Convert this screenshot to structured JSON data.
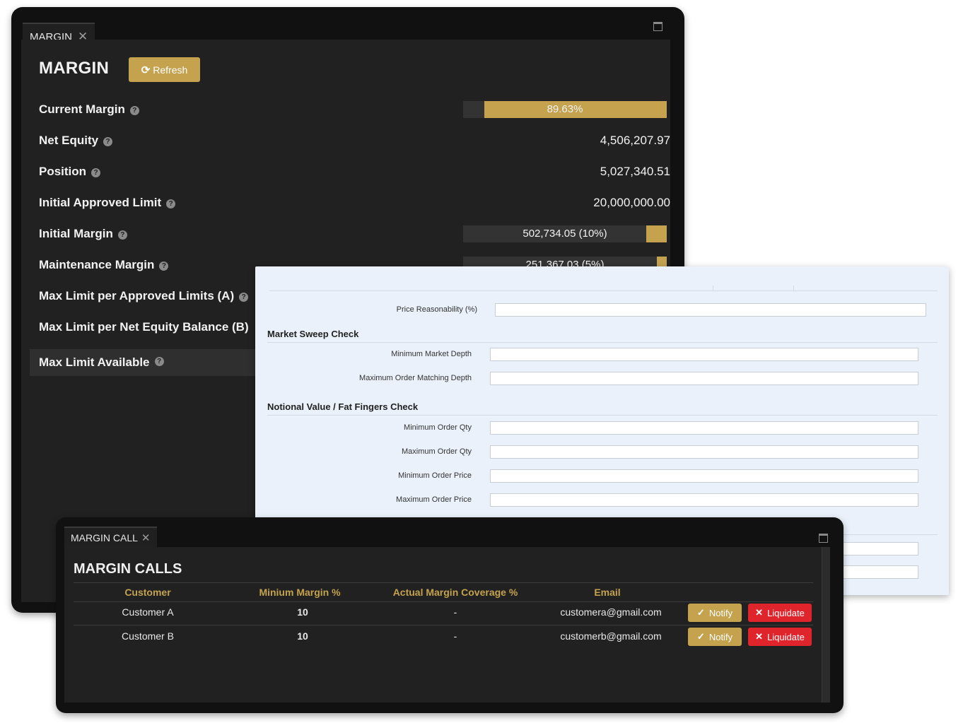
{
  "margin_window": {
    "tab_label": "MARGIN",
    "tab_close": "✕",
    "title": "MARGIN",
    "refresh_label": "Refresh",
    "rows": [
      {
        "label": "Current Margin",
        "bar_text": "89.63%",
        "bar_fill_percent": 89.63
      },
      {
        "label": "Net Equity",
        "value": "4,506,207.97"
      },
      {
        "label": "Position",
        "value": "5,027,340.51"
      },
      {
        "label": "Initial Approved Limit",
        "value": "20,000,000.00"
      },
      {
        "label": "Initial Margin",
        "bar_text": "502,734.05 (10%)",
        "bar_fill_percent": 10
      },
      {
        "label": "Maintenance Margin",
        "bar_text": "251,367.03 (5%)",
        "bar_fill_percent": 5
      },
      {
        "label": "Max Limit per Approved Limits (A)"
      },
      {
        "label": "Max Limit per Net Equity Balance (B)"
      },
      {
        "label": "Max Limit Available"
      }
    ]
  },
  "settings_form": {
    "fields": [
      {
        "label": "Price Reasonability (%)",
        "value": ""
      },
      {
        "label": "Minimum Market Depth",
        "value": ""
      },
      {
        "label": "Maximum Order Matching Depth",
        "value": ""
      },
      {
        "label": "Minimum Order Qty",
        "value": ""
      },
      {
        "label": "Maximum Order Qty",
        "value": ""
      },
      {
        "label": "Minimum Order Price",
        "value": ""
      },
      {
        "label": "Maximum Order Price",
        "value": ""
      }
    ],
    "sections": {
      "market_sweep": "Market Sweep Check",
      "notional": "Notional Value / Fat Fingers Check"
    }
  },
  "margin_call_window": {
    "tab_label": "MARGIN CALL",
    "tab_close": "✕",
    "title": "MARGIN CALLS",
    "columns": [
      "Customer",
      "Minium Margin %",
      "Actual Margin Coverage %",
      "Email"
    ],
    "rows": [
      {
        "customer": "Customer A",
        "min_margin": "10",
        "actual_coverage": "-",
        "email": "customera@gmail.com"
      },
      {
        "customer": "Customer B",
        "min_margin": "10",
        "actual_coverage": "-",
        "email": "customerb@gmail.com"
      }
    ],
    "notify_label": "Notify",
    "liquidate_label": "Liquidate"
  },
  "colors": {
    "accent_gold": "#c4a24e",
    "danger_red": "#e0242c",
    "panel_dark": "#212121",
    "form_bg": "#eaf1fa"
  },
  "icons": {
    "help": "question-circle-icon",
    "refresh": "refresh-icon",
    "maximize": "window-maximize-icon",
    "check": "check-icon",
    "times": "times-icon"
  }
}
